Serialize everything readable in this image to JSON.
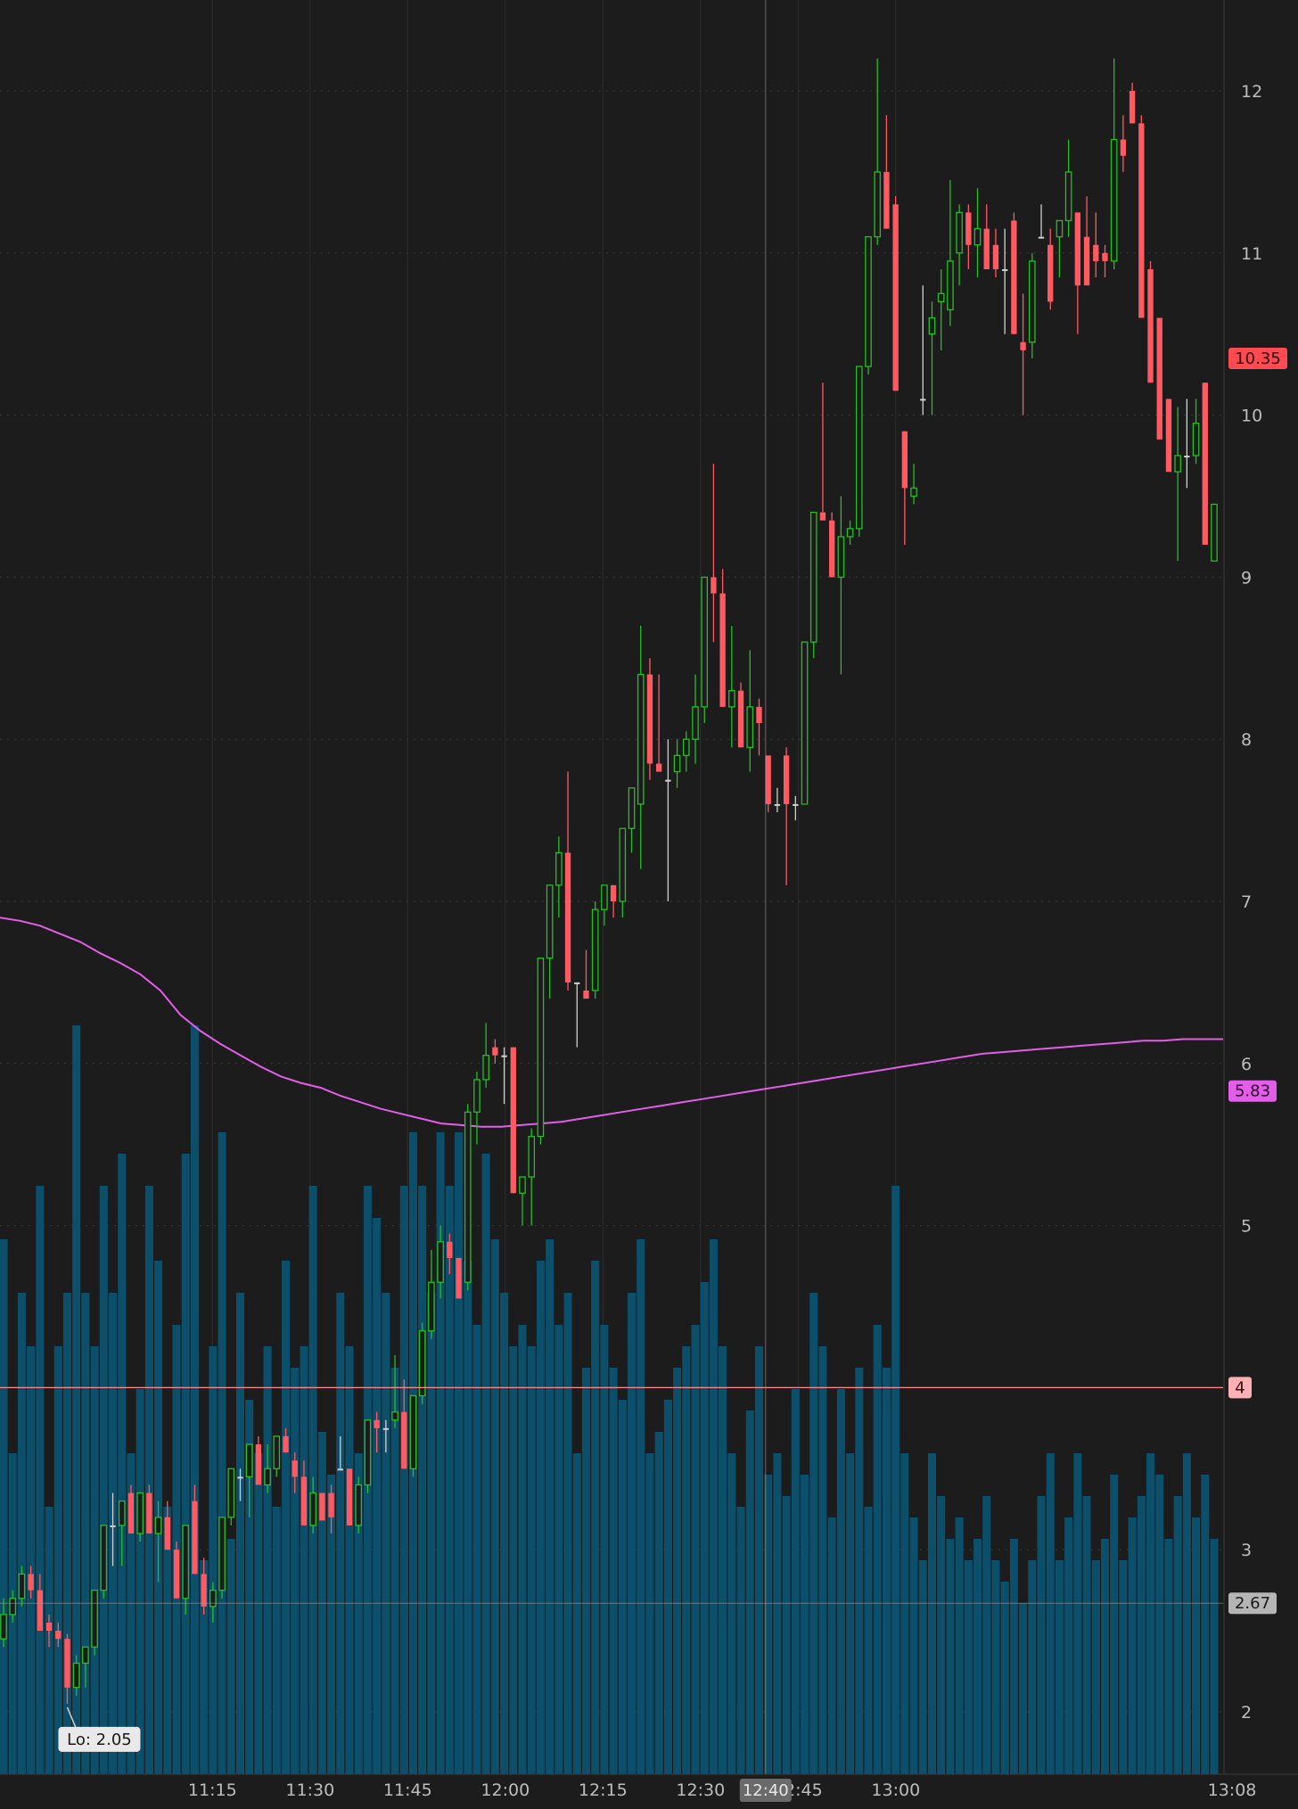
{
  "chart_data": {
    "type": "candlestick",
    "title": "",
    "xlabel": "",
    "ylabel": "",
    "ylim": [
      1.7,
      12.6
    ],
    "y_ticks": [
      2,
      3,
      4,
      5,
      6,
      7,
      8,
      9,
      10,
      11,
      12
    ],
    "x_ticks": [
      "11:15",
      "11:30",
      "11:45",
      "12:00",
      "12:15",
      "12:30",
      "12:45",
      "13:00",
      "13:08"
    ],
    "grid": true,
    "markers": {
      "last_price": "10.35",
      "moving_average": "5.83",
      "level_line": "4",
      "cursor_price": "2.67",
      "cursor_time": "12:40",
      "low_label": "Lo: 2.05"
    },
    "colors": {
      "background": "#1c1c1c",
      "up": "#22c022",
      "down": "#ff5a62",
      "volume": "#0c4f6b",
      "moving_average": "#e35ee8",
      "level_line": "#ff8a8f"
    },
    "ohlc": [
      [
        2.45,
        2.7,
        2.4,
        2.6
      ],
      [
        2.6,
        2.75,
        2.55,
        2.7
      ],
      [
        2.7,
        2.9,
        2.65,
        2.85
      ],
      [
        2.85,
        2.9,
        2.7,
        2.75
      ],
      [
        2.75,
        2.85,
        2.5,
        2.5
      ],
      [
        2.55,
        2.6,
        2.4,
        2.5
      ],
      [
        2.5,
        2.55,
        2.4,
        2.45
      ],
      [
        2.45,
        2.48,
        2.05,
        2.15
      ],
      [
        2.15,
        2.35,
        2.1,
        2.3
      ],
      [
        2.3,
        2.4,
        2.15,
        2.4
      ],
      [
        2.4,
        2.75,
        2.35,
        2.75
      ],
      [
        2.75,
        3.15,
        2.7,
        3.15
      ],
      [
        3.15,
        3.35,
        2.9,
        3.15
      ],
      [
        3.15,
        3.3,
        2.9,
        3.3
      ],
      [
        3.35,
        3.4,
        3.1,
        3.1
      ],
      [
        3.1,
        3.35,
        3.05,
        3.35
      ],
      [
        3.35,
        3.4,
        3.1,
        3.1
      ],
      [
        3.1,
        3.3,
        2.8,
        3.2
      ],
      [
        3.2,
        3.3,
        3.0,
        3.0
      ],
      [
        3.0,
        3.05,
        2.7,
        2.7
      ],
      [
        2.7,
        3.15,
        2.6,
        3.15
      ],
      [
        3.3,
        3.4,
        2.85,
        2.85
      ],
      [
        2.85,
        2.95,
        2.6,
        2.65
      ],
      [
        2.65,
        2.8,
        2.55,
        2.75
      ],
      [
        2.75,
        3.2,
        2.7,
        3.2
      ],
      [
        3.2,
        3.5,
        3.15,
        3.5
      ],
      [
        3.45,
        3.5,
        3.3,
        3.45
      ],
      [
        3.45,
        3.65,
        3.2,
        3.65
      ],
      [
        3.65,
        3.7,
        3.4,
        3.4
      ],
      [
        3.4,
        3.65,
        3.35,
        3.5
      ],
      [
        3.5,
        3.7,
        3.45,
        3.7
      ],
      [
        3.7,
        3.75,
        3.6,
        3.6
      ],
      [
        3.55,
        3.6,
        3.35,
        3.45
      ],
      [
        3.45,
        3.55,
        3.15,
        3.15
      ],
      [
        3.15,
        3.45,
        3.1,
        3.35
      ],
      [
        3.35,
        3.35,
        3.18,
        3.18
      ],
      [
        3.35,
        3.4,
        3.1,
        3.2
      ],
      [
        3.5,
        3.7,
        3.5,
        3.5
      ],
      [
        3.5,
        3.5,
        3.15,
        3.15
      ],
      [
        3.15,
        3.45,
        3.1,
        3.4
      ],
      [
        3.4,
        3.8,
        3.35,
        3.8
      ],
      [
        3.8,
        3.85,
        3.6,
        3.75
      ],
      [
        3.75,
        3.8,
        3.6,
        3.75
      ],
      [
        3.8,
        4.2,
        3.75,
        3.85
      ],
      [
        3.85,
        4.05,
        3.5,
        3.5
      ],
      [
        3.5,
        3.95,
        3.45,
        3.95
      ],
      [
        3.95,
        4.4,
        3.9,
        4.35
      ],
      [
        4.35,
        4.85,
        4.3,
        4.65
      ],
      [
        4.65,
        5.0,
        4.55,
        4.9
      ],
      [
        4.9,
        4.95,
        4.7,
        4.8
      ],
      [
        4.8,
        4.8,
        4.55,
        4.55
      ],
      [
        4.65,
        5.75,
        4.6,
        5.7
      ],
      [
        5.7,
        5.95,
        5.5,
        5.9
      ],
      [
        5.9,
        6.25,
        5.85,
        6.05
      ],
      [
        6.1,
        6.15,
        6.0,
        6.05
      ],
      [
        6.05,
        6.1,
        5.75,
        6.05
      ],
      [
        6.1,
        6.1,
        5.2,
        5.2
      ],
      [
        5.2,
        5.3,
        5.0,
        5.3
      ],
      [
        5.3,
        5.6,
        5.0,
        5.55
      ],
      [
        5.55,
        6.65,
        5.5,
        6.65
      ],
      [
        6.65,
        7.1,
        6.4,
        7.1
      ],
      [
        7.1,
        7.4,
        6.9,
        7.3
      ],
      [
        7.3,
        7.8,
        6.45,
        6.5
      ],
      [
        6.5,
        6.5,
        6.1,
        6.5
      ],
      [
        6.45,
        6.7,
        6.4,
        6.4
      ],
      [
        6.45,
        7.0,
        6.4,
        6.95
      ],
      [
        6.95,
        7.1,
        6.85,
        7.1
      ],
      [
        7.1,
        7.1,
        6.9,
        7.0
      ],
      [
        7.0,
        7.45,
        6.9,
        7.45
      ],
      [
        7.45,
        7.6,
        7.3,
        7.7
      ],
      [
        7.6,
        8.7,
        7.2,
        8.4
      ],
      [
        8.4,
        8.5,
        7.75,
        7.85
      ],
      [
        7.85,
        8.4,
        7.8,
        7.8
      ],
      [
        7.75,
        8.0,
        7.0,
        7.75
      ],
      [
        7.8,
        8.0,
        7.7,
        7.9
      ],
      [
        7.9,
        8.05,
        7.8,
        8.0
      ],
      [
        8.0,
        8.4,
        7.85,
        8.2
      ],
      [
        8.2,
        9.0,
        8.1,
        9.0
      ],
      [
        9.0,
        9.7,
        8.6,
        8.9
      ],
      [
        8.9,
        9.05,
        8.2,
        8.2
      ],
      [
        8.2,
        8.7,
        7.95,
        8.3
      ],
      [
        8.3,
        8.35,
        7.95,
        7.95
      ],
      [
        7.95,
        8.55,
        7.8,
        8.2
      ],
      [
        8.2,
        8.25,
        7.9,
        8.1
      ],
      [
        7.9,
        7.9,
        7.55,
        7.6
      ],
      [
        7.6,
        7.7,
        7.55,
        7.6
      ],
      [
        7.9,
        7.95,
        7.1,
        7.6
      ],
      [
        7.6,
        7.65,
        7.5,
        7.6
      ],
      [
        7.6,
        8.6,
        7.6,
        8.6
      ],
      [
        8.6,
        9.4,
        8.5,
        9.4
      ],
      [
        9.4,
        10.2,
        9.4,
        9.35
      ],
      [
        9.35,
        9.4,
        9.0,
        9.0
      ],
      [
        9.0,
        9.5,
        8.4,
        9.25
      ],
      [
        9.25,
        9.35,
        9.2,
        9.3
      ],
      [
        9.3,
        10.3,
        9.25,
        10.3
      ],
      [
        10.3,
        11.1,
        10.25,
        11.1
      ],
      [
        11.1,
        12.2,
        11.05,
        11.5
      ],
      [
        11.5,
        11.85,
        11.15,
        11.15
      ],
      [
        11.3,
        11.35,
        10.15,
        10.15
      ],
      [
        9.9,
        9.9,
        9.2,
        9.55
      ],
      [
        9.5,
        9.7,
        9.45,
        9.55
      ],
      [
        10.1,
        10.8,
        10.0,
        10.1
      ],
      [
        10.5,
        10.7,
        10.0,
        10.6
      ],
      [
        10.7,
        10.9,
        10.4,
        10.75
      ],
      [
        10.65,
        11.45,
        10.55,
        10.95
      ],
      [
        11.0,
        11.3,
        10.8,
        11.25
      ],
      [
        11.25,
        11.3,
        10.9,
        11.05
      ],
      [
        11.05,
        11.4,
        10.85,
        11.15
      ],
      [
        11.15,
        11.3,
        10.9,
        10.9
      ],
      [
        11.05,
        11.15,
        10.85,
        10.9
      ],
      [
        10.9,
        11.15,
        10.5,
        10.9
      ],
      [
        11.2,
        11.25,
        10.5,
        10.5
      ],
      [
        10.45,
        10.75,
        10.0,
        10.4
      ],
      [
        10.45,
        11.0,
        10.35,
        10.95
      ],
      [
        11.1,
        11.3,
        11.1,
        11.1
      ],
      [
        11.05,
        11.15,
        10.65,
        10.7
      ],
      [
        11.1,
        11.2,
        10.85,
        11.2
      ],
      [
        11.2,
        11.7,
        11.1,
        11.5
      ],
      [
        11.25,
        11.25,
        10.5,
        10.8
      ],
      [
        11.1,
        11.35,
        10.85,
        10.8
      ],
      [
        11.05,
        11.25,
        10.85,
        10.95
      ],
      [
        11.0,
        11.05,
        10.85,
        10.95
      ],
      [
        10.95,
        12.2,
        10.9,
        11.7
      ],
      [
        11.7,
        11.85,
        11.5,
        11.6
      ],
      [
        12.0,
        12.05,
        11.8,
        11.8
      ],
      [
        11.8,
        11.85,
        10.6,
        10.6
      ],
      [
        10.9,
        10.95,
        10.2,
        10.2
      ],
      [
        10.6,
        10.6,
        9.85,
        9.85
      ],
      [
        10.1,
        10.1,
        9.65,
        9.65
      ],
      [
        9.65,
        10.05,
        9.1,
        9.75
      ],
      [
        9.75,
        10.1,
        9.55,
        9.75
      ],
      [
        9.75,
        10.1,
        9.7,
        9.95
      ],
      [
        10.2,
        10.2,
        9.2,
        9.2
      ],
      [
        9.1,
        9.45,
        9.1,
        9.45
      ]
    ],
    "volume": [
      0.5,
      0.3,
      0.45,
      0.4,
      0.55,
      0.25,
      0.4,
      0.45,
      0.7,
      0.45,
      0.4,
      0.55,
      0.45,
      0.58,
      0.3,
      0.36,
      0.55,
      0.48,
      0.25,
      0.42,
      0.58,
      0.7,
      0.2,
      0.4,
      0.6,
      0.22,
      0.45,
      0.35,
      0.3,
      0.4,
      0.25,
      0.48,
      0.38,
      0.4,
      0.55,
      0.32,
      0.28,
      0.45,
      0.4,
      0.3,
      0.55,
      0.52,
      0.45,
      0.38,
      0.55,
      0.6,
      0.55,
      0.45,
      0.6,
      0.55,
      0.6,
      0.48,
      0.42,
      0.58,
      0.5,
      0.45,
      0.4,
      0.42,
      0.4,
      0.48,
      0.5,
      0.42,
      0.45,
      0.3,
      0.38,
      0.48,
      0.42,
      0.38,
      0.35,
      0.45,
      0.5,
      0.3,
      0.32,
      0.35,
      0.38,
      0.4,
      0.42,
      0.46,
      0.5,
      0.4,
      0.3,
      0.25,
      0.34,
      0.4,
      0.28,
      0.3,
      0.26,
      0.36,
      0.28,
      0.45,
      0.4,
      0.24,
      0.36,
      0.3,
      0.38,
      0.25,
      0.42,
      0.38,
      0.55,
      0.3,
      0.24,
      0.2,
      0.3,
      0.26,
      0.22,
      0.24,
      0.2,
      0.22,
      0.26,
      0.2,
      0.18,
      0.22,
      0.16,
      0.2,
      0.26,
      0.3,
      0.2,
      0.24,
      0.3,
      0.26,
      0.2,
      0.22,
      0.28,
      0.2,
      0.24,
      0.26,
      0.3,
      0.28,
      0.22,
      0.26,
      0.3,
      0.24,
      0.28,
      0.22,
      0.26,
      0.3,
      0.25,
      0.28
    ],
    "moving_average_path": [
      6.9,
      6.88,
      6.85,
      6.8,
      6.75,
      6.68,
      6.62,
      6.55,
      6.45,
      6.3,
      6.2,
      6.12,
      6.05,
      5.98,
      5.92,
      5.88,
      5.85,
      5.8,
      5.76,
      5.72,
      5.69,
      5.66,
      5.63,
      5.62,
      5.61,
      5.61,
      5.62,
      5.63,
      5.64,
      5.66,
      5.68,
      5.7,
      5.72,
      5.74,
      5.76,
      5.78,
      5.8,
      5.82,
      5.84,
      5.86,
      5.88,
      5.9,
      5.92,
      5.94,
      5.96,
      5.98,
      6.0,
      6.02,
      6.04,
      6.06,
      6.07,
      6.08,
      6.09,
      6.1,
      6.11,
      6.12,
      6.13,
      6.14,
      6.14,
      6.15,
      6.15,
      6.15
    ],
    "moving_average_x_span_minutes": [
      0,
      142
    ]
  }
}
